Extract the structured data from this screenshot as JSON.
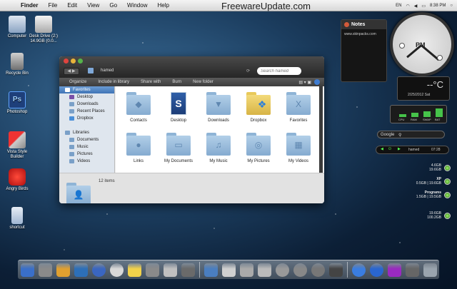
{
  "menubar": {
    "items": [
      "Finder",
      "File",
      "Edit",
      "View",
      "Go",
      "Window",
      "Help"
    ],
    "watermark": "FreewareUpdate.com",
    "lang": "EN",
    "clock": "8:38 PM"
  },
  "desktop_icons": [
    {
      "label": "Computer",
      "icon": "computer-icon"
    },
    {
      "label": "Desk Drive (2:) 14.9GB (0.0...",
      "icon": "drive-icon"
    },
    {
      "label": "Recycle Bin",
      "icon": "trash-icon"
    },
    {
      "label": "Photoshop",
      "icon": "photoshop-icon"
    },
    {
      "label": "Vista Style Builder",
      "icon": "builder-icon"
    },
    {
      "label": "Angry Birds",
      "icon": "bird-icon"
    },
    {
      "label": "shortcut",
      "icon": "shortcut-icon"
    }
  ],
  "finder": {
    "title": "hamed",
    "search_placeholder": "Search hamed",
    "toolbar": [
      "Organize",
      "Include in library",
      "Share with",
      "Burn",
      "New folder"
    ],
    "sidebar": [
      {
        "label": "Favorites",
        "selected": true,
        "color": "#ffffff"
      },
      {
        "label": "Desktop",
        "selected": false,
        "color": "#7a4fa8"
      },
      {
        "label": "Downloads",
        "selected": false,
        "color": "#7aa0c8"
      },
      {
        "label": "Recent Places",
        "selected": false,
        "color": "#7aa0c8"
      },
      {
        "label": "Dropbox",
        "selected": false,
        "color": "#4a8fd8"
      },
      {
        "label": "Libraries",
        "selected": false,
        "color": "#7aa0c8"
      },
      {
        "label": "Documents",
        "selected": false,
        "color": "#7aa0c8"
      },
      {
        "label": "Music",
        "selected": false,
        "color": "#7aa0c8"
      },
      {
        "label": "Pictures",
        "selected": false,
        "color": "#7aa0c8"
      },
      {
        "label": "Videos",
        "selected": false,
        "color": "#7aa0c8"
      }
    ],
    "items": [
      {
        "label": "Contacts",
        "glyph": "◆"
      },
      {
        "label": "Desktop",
        "glyph": "S"
      },
      {
        "label": "Downloads",
        "glyph": "▼"
      },
      {
        "label": "Dropbox",
        "glyph": "❖"
      },
      {
        "label": "Favorites",
        "glyph": "X"
      },
      {
        "label": "Links",
        "glyph": "●"
      },
      {
        "label": "My Documents",
        "glyph": "▭"
      },
      {
        "label": "My Music",
        "glyph": "♫"
      },
      {
        "label": "My Pictures",
        "glyph": "◎"
      },
      {
        "label": "My Videos",
        "glyph": "▦"
      }
    ],
    "status": "12 items"
  },
  "notes": {
    "title": "Notes",
    "body": "www.skinpacks.com"
  },
  "clock_widget": {
    "label": "PM"
  },
  "weather": {
    "temp": "--°C",
    "date": "2/25/2012 Sat"
  },
  "meter": {
    "labels": [
      "CPU",
      "RAM",
      "SWAP",
      "BAT"
    ],
    "levels": [
      0.3,
      0.45,
      0.6,
      0.85
    ]
  },
  "google": {
    "label": "Google"
  },
  "player": {
    "user": "hamed",
    "time": "07:28"
  },
  "drives": [
    {
      "line1": "4.6GB",
      "line2": "19.6GB"
    },
    {
      "line1": "XP",
      "line2": "0.5GB | 19.6GB"
    },
    {
      "line1": "Programs",
      "line2": "1.5GB | 19.5GB"
    },
    {
      "line1": "19.6GB",
      "line2": "100.2GB"
    }
  ],
  "dock": [
    "#3a6fc9",
    "#8a8a8a",
    "#e0a030",
    "#2d6fb8",
    "#3a66c0",
    "#d8d8d8",
    "#f2d24a",
    "#8a8a8a",
    "#c0c0c0",
    "#6a6a6a",
    "#4a7ec0",
    "#d0d0d0",
    "#aaaaaa",
    "#bbbbbb",
    "#999999",
    "#888888",
    "#777777",
    "#444444",
    "#3a7de0",
    "#2a66d0",
    "#9a2ac0",
    "#666666",
    "#9aa4ae"
  ]
}
